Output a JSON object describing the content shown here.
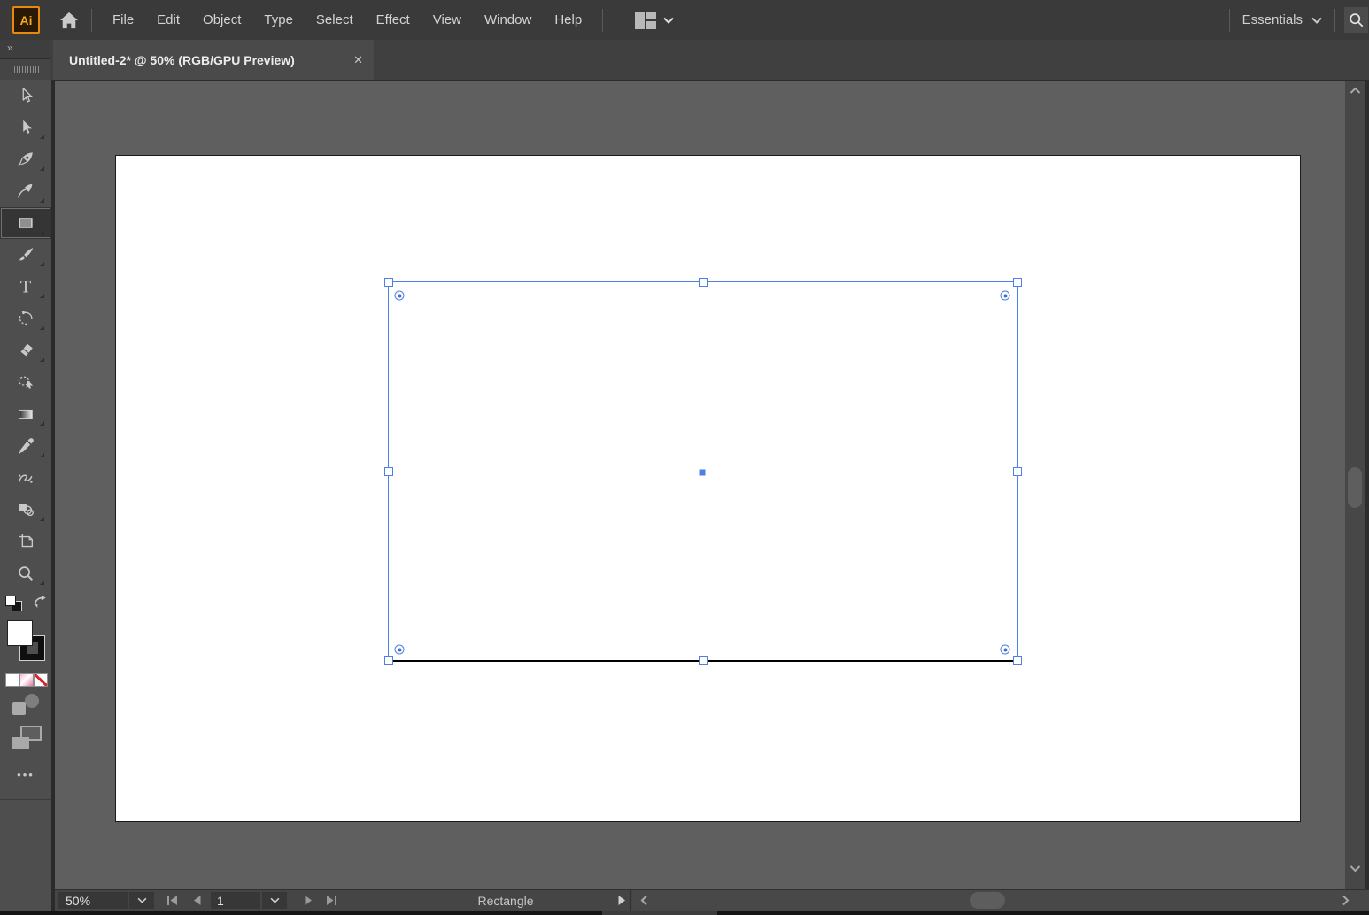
{
  "menubar": {
    "logo_text": "Ai",
    "items": [
      "File",
      "Edit",
      "Object",
      "Type",
      "Select",
      "Effect",
      "View",
      "Window",
      "Help"
    ],
    "workspace_label": "Essentials",
    "icons": [
      "home-icon",
      "arrange-documents-icon",
      "chevron-down-icon",
      "search-icon"
    ]
  },
  "tabbar": {
    "expander_glyph": "»",
    "tab_title": "Untitled-2* @ 50% (RGB/GPU Preview)",
    "close_glyph": "✕"
  },
  "toolbar": {
    "tools": [
      "selection",
      "direct-selection",
      "pen",
      "curvature",
      "rectangle",
      "paintbrush",
      "type",
      "rotate",
      "eraser",
      "lasso",
      "gradient",
      "eyedropper",
      "puppet-warp",
      "shape-builder",
      "artboard",
      "zoom"
    ],
    "selected_tool": "rectangle",
    "more_glyph": "•••"
  },
  "statusbar": {
    "zoom_level": "50%",
    "artboard_number": "1",
    "status_text": "Rectangle"
  },
  "colors": {
    "selection_blue": "#4d7fe4",
    "logo_orange": "#e8890c",
    "artboard_white": "#ffffff",
    "pasteboard_gray": "#5f5f5f"
  }
}
